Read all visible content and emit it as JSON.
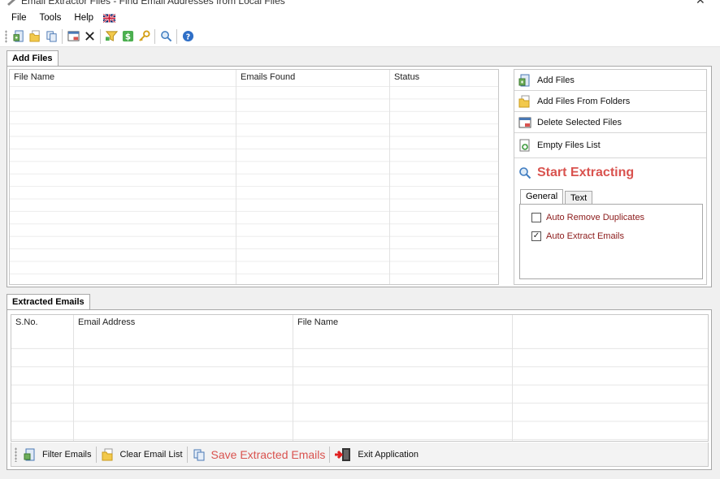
{
  "window": {
    "title": "Email Extractor Files - Find Email Addresses from Local Files"
  },
  "menu": {
    "items": [
      "File",
      "Tools",
      "Help"
    ],
    "flag_icon": "uk-flag-icon"
  },
  "toolbar": {
    "icons": [
      "add-files-icon",
      "add-folder-icon",
      "copy-icon",
      "delete-selected-icon",
      "clear-x-icon",
      "filter-icon",
      "dollar-icon",
      "key-icon",
      "search-icon",
      "help-icon"
    ]
  },
  "add_files": {
    "tab_label": "Add Files",
    "columns": [
      "File Name",
      "Emails Found",
      "Status"
    ],
    "rows": []
  },
  "side_panel": {
    "add_files": "Add Files",
    "add_files_from_folders": "Add Files From Folders",
    "delete_selected_files": "Delete Selected Files",
    "empty_files_list": "Empty Files List",
    "start_extracting": "Start Extracting"
  },
  "options": {
    "tabs": [
      "General",
      "Text"
    ],
    "active_tab": "General",
    "remove_duplicates": {
      "label": "Auto Remove Duplicates",
      "checked": false
    },
    "extract_emails": {
      "label": "Auto Extract Emails",
      "checked": true
    }
  },
  "extracted_emails": {
    "tab_label": "Extracted Emails",
    "columns": [
      "S.No.",
      "Email Address",
      "File Name"
    ],
    "rows": []
  },
  "bottom_bar": {
    "filter_emails": "Filter Emails",
    "clear_email_list": "Clear Email List",
    "save_extracted_emails": "Save Extracted Emails",
    "exit_application": "Exit Application"
  },
  "colors": {
    "accent_red": "#d9534f",
    "option_label": "#8b1a1a"
  }
}
